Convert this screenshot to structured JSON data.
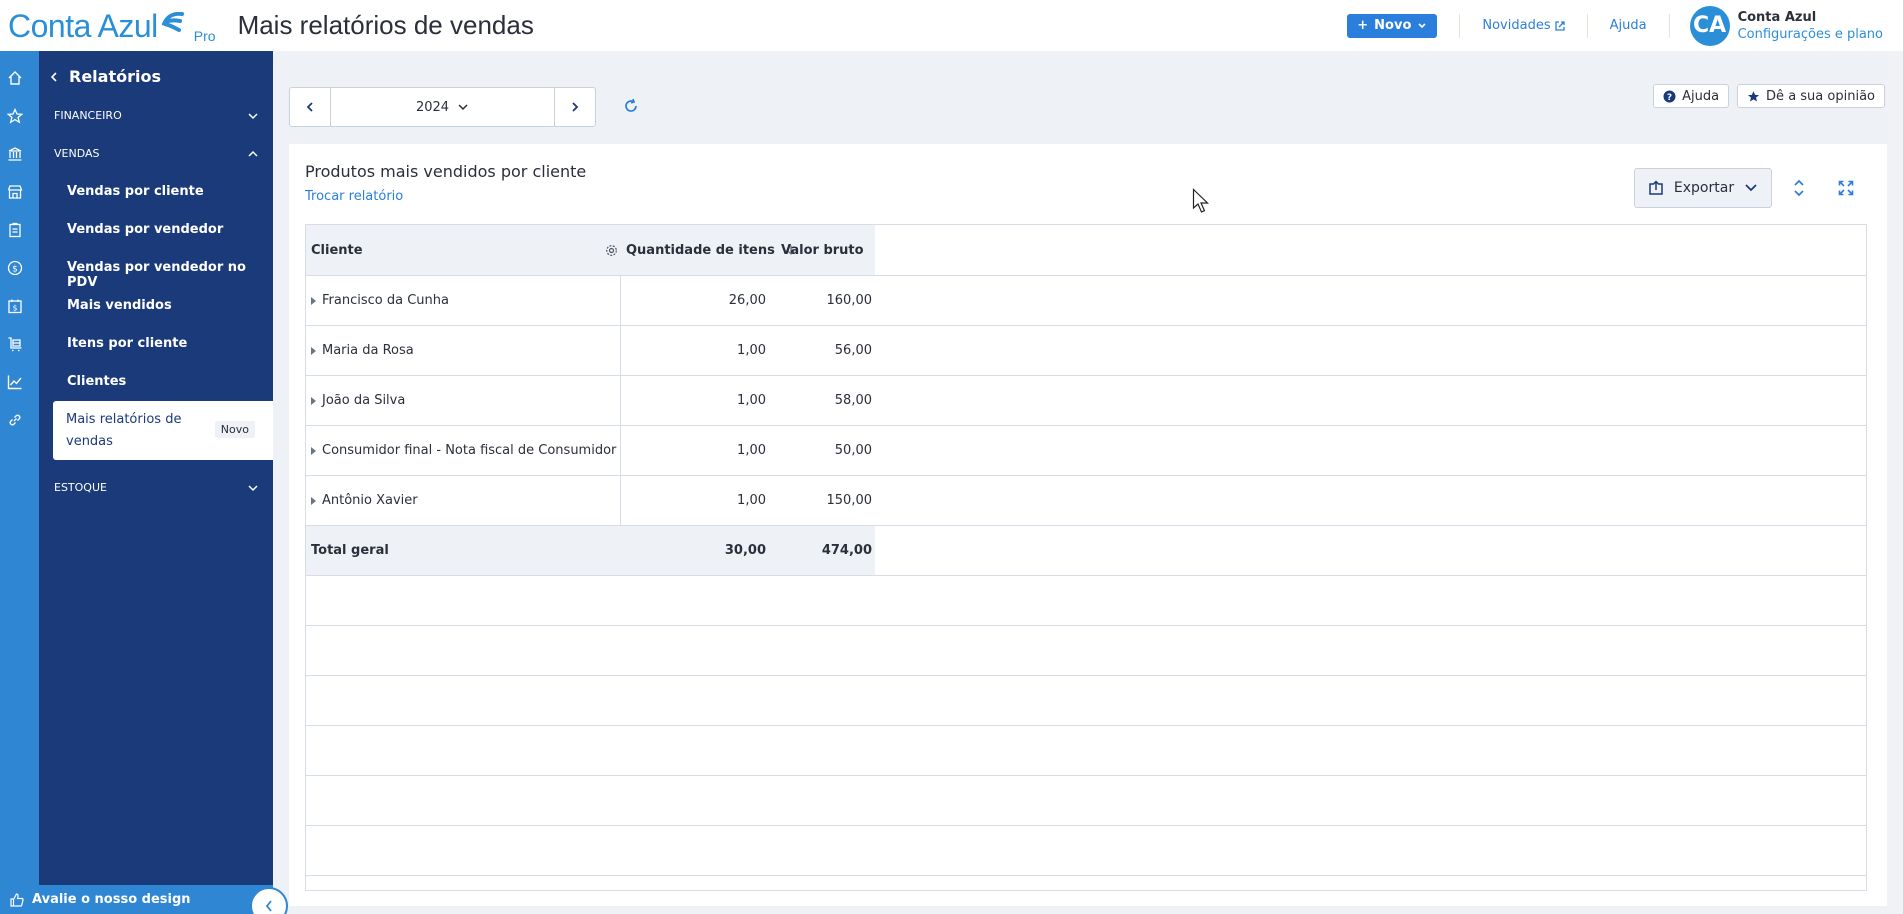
{
  "app": {
    "logo_text": "Conta Azul",
    "logo_badge": "Pro",
    "page_title": "Mais relatórios de vendas",
    "brand_color": "#2b8fd8",
    "sidebar_color": "#1a3a7a",
    "accent_color": "#2b7fdc"
  },
  "header": {
    "new_button": "Novo",
    "news_link": "Novidades",
    "help_link": "Ajuda",
    "avatar_initials": "CA",
    "user_name": "Conta Azul",
    "user_settings": "Configurações e plano"
  },
  "rail": {
    "icons": [
      "home-icon",
      "star-icon",
      "bank-icon",
      "store-icon",
      "clipboard-icon",
      "dollar-circle-icon",
      "calendar-dollar-icon",
      "inventory-icon",
      "chart-icon",
      "link-icon"
    ],
    "active_icon": "chart-icon"
  },
  "sidebar": {
    "back_label": "Relatórios",
    "sections": {
      "financeiro": "FINANCEIRO",
      "vendas": "VENDAS",
      "estoque": "ESTOQUE"
    },
    "items": [
      {
        "label": "Vendas por cliente"
      },
      {
        "label": "Vendas por vendedor"
      },
      {
        "label": "Vendas por vendedor no PDV"
      },
      {
        "label": "Mais vendidos"
      },
      {
        "label": "Itens por cliente"
      },
      {
        "label": "Clientes"
      }
    ],
    "active_item": {
      "label": "Mais relatórios de vendas",
      "badge": "Novo"
    },
    "footer": "Avalie o nosso design"
  },
  "toolbar": {
    "period": "2024",
    "help_button": "Ajuda",
    "feedback_button": "Dê a sua opinião"
  },
  "report": {
    "title": "Produtos mais vendidos por cliente",
    "switch_link": "Trocar relatório",
    "export_button": "Exportar",
    "columns": {
      "client": "Cliente",
      "quantity": "Quantidade de itens",
      "gross": "Valor bruto"
    },
    "rows": [
      {
        "client": "Francisco da Cunha",
        "quantity": "26,00",
        "gross": "160,00"
      },
      {
        "client": "Maria da Rosa",
        "quantity": "1,00",
        "gross": "56,00"
      },
      {
        "client": "João da Silva",
        "quantity": "1,00",
        "gross": "58,00"
      },
      {
        "client": "Consumidor final - Nota fiscal de Consumidor",
        "quantity": "1,00",
        "gross": "50,00"
      },
      {
        "client": "Antônio Xavier",
        "quantity": "1,00",
        "gross": "150,00"
      }
    ],
    "total": {
      "label": "Total geral",
      "quantity": "30,00",
      "gross": "474,00"
    }
  }
}
